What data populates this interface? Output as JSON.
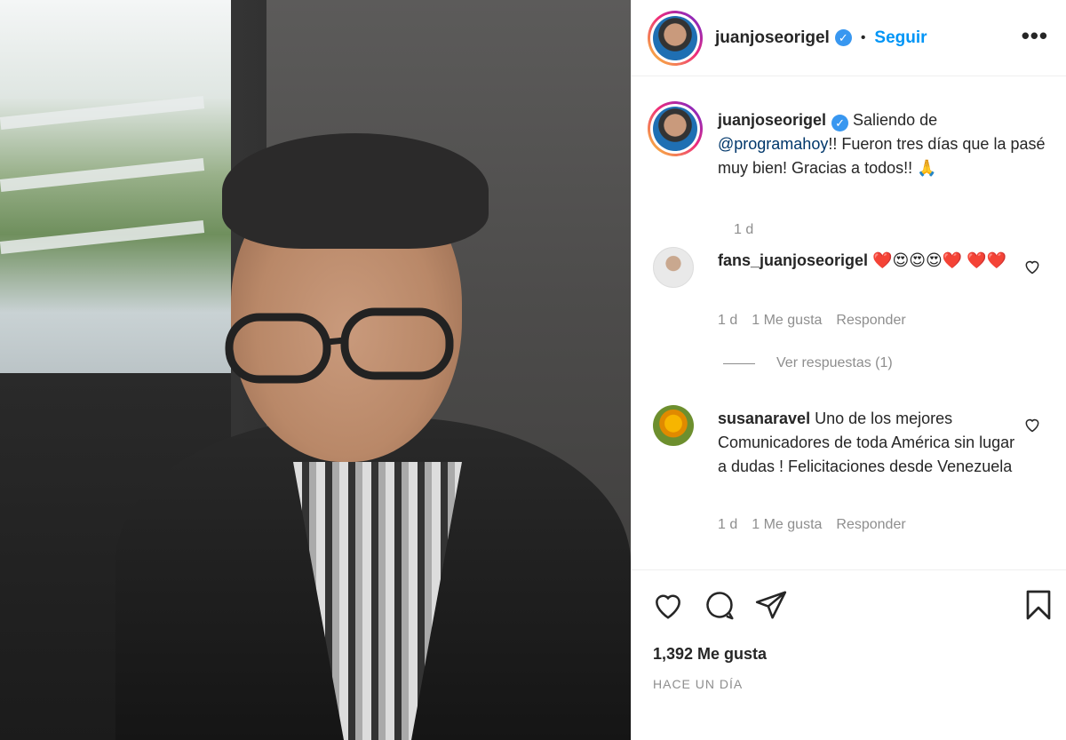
{
  "post": {
    "photo_alt": "selfie"
  },
  "header": {
    "username": "juanjoseorigel",
    "verified_mark": "✓",
    "separator": "•",
    "follow_label": "Seguir",
    "more_label": "•••"
  },
  "caption": {
    "username": "juanjoseorigel",
    "text_before": " Saliendo de ",
    "mention": "@programahoy",
    "text_after": "!! Fueron tres días que la pasé muy bien! Gracias a todos!! 🙏",
    "time": "1 d"
  },
  "comments": [
    {
      "username": "fans_juanjoseorigel",
      "text": " ❤️😍😍😍❤️ ❤️❤️",
      "time": "1 d",
      "likes": "1 Me gusta",
      "reply_label": "Responder"
    },
    {
      "username": "susanaravel",
      "text": " Uno de los mejores Comunicadores de toda América sin lugar a dudas ! Felicitaciones desde Venezuela",
      "time": "1 d",
      "likes": "1 Me gusta",
      "reply_label": "Responder"
    }
  ],
  "view_replies": "Ver respuestas (1)",
  "footer": {
    "likes": "1,392 Me gusta",
    "timestamp": "HACE UN DÍA"
  },
  "icons": {
    "like": "heart-icon",
    "comment": "comment-icon",
    "share": "share-icon",
    "save": "bookmark-icon",
    "more": "more-options-icon",
    "verified": "verified-badge-icon"
  },
  "colors": {
    "follow": "#0095f6",
    "verified": "#3897f0",
    "mention": "#00376b",
    "muted": "#8e8e8e"
  }
}
